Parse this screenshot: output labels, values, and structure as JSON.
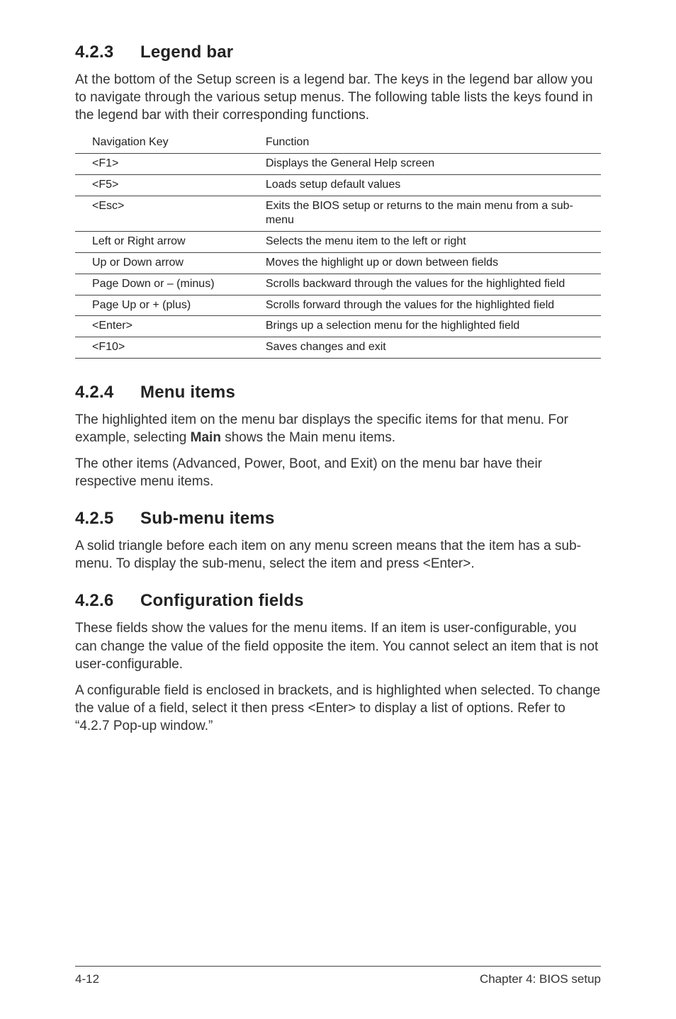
{
  "sections": {
    "s423": {
      "number": "4.2.3",
      "title": "Legend bar",
      "para": "At the bottom of the Setup screen is a legend bar. The keys in the legend bar allow you to navigate through the various setup menus. The following table lists the keys found in the legend bar with their corresponding functions."
    },
    "s424": {
      "number": "4.2.4",
      "title": "Menu items",
      "para1_prefix": "The highlighted item on the menu bar  displays the specific items for that menu. For example, selecting ",
      "para1_bold": "Main",
      "para1_suffix": " shows the Main menu items.",
      "para2": "The other items (Advanced, Power, Boot, and Exit) on the menu bar have their respective menu items."
    },
    "s425": {
      "number": "4.2.5",
      "title": "Sub-menu items",
      "para": "A solid triangle before each item on any menu screen means that the item has a sub-menu. To display the sub-menu, select the item and press <Enter>."
    },
    "s426": {
      "number": "4.2.6",
      "title": "Configuration fields",
      "para1": "These fields show the values for the menu items. If an item is user-configurable, you can change the value of the field opposite the item. You cannot select an item that is not user-configurable.",
      "para2": "A configurable field is enclosed in brackets, and is highlighted when selected. To change the value of a field, select it then press <Enter> to display a list of options. Refer to “4.2.7 Pop-up window.”"
    }
  },
  "table": {
    "headers": {
      "col1": "Navigation Key",
      "col2": "Function"
    },
    "rows": [
      {
        "key": "<F1>",
        "func": "Displays the General Help screen"
      },
      {
        "key": "<F5>",
        "func": "Loads setup default values"
      },
      {
        "key": "<Esc>",
        "func": "Exits the BIOS setup or returns to the main menu from a sub-menu"
      },
      {
        "key": "Left or Right arrow",
        "func": "Selects the menu item to the left or right"
      },
      {
        "key": "Up or Down arrow",
        "func": "Moves the highlight up or down between fields"
      },
      {
        "key": "Page Down or – (minus)",
        "func": "Scrolls backward through the values for the highlighted field"
      },
      {
        "key": "Page Up or + (plus)",
        "func": "Scrolls forward through the values for the highlighted field"
      },
      {
        "key": "<Enter>",
        "func": "Brings up a selection menu for the highlighted field"
      },
      {
        "key": "<F10>",
        "func": "Saves changes and exit"
      }
    ]
  },
  "footer": {
    "left": "4-12",
    "right": "Chapter 4: BIOS setup"
  }
}
